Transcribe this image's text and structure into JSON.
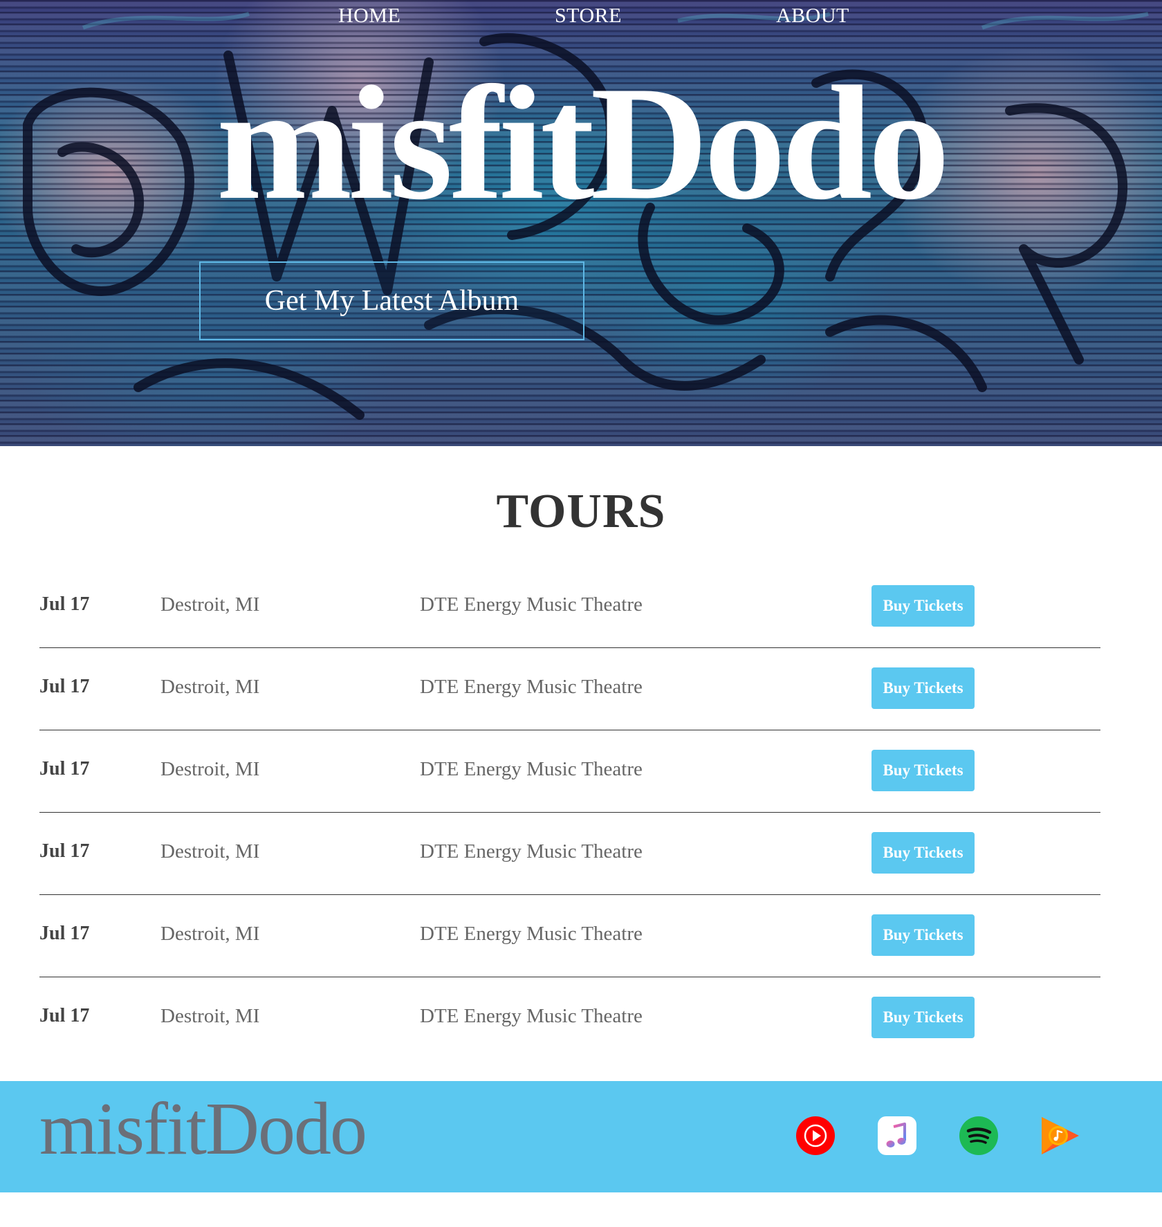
{
  "nav": {
    "home": "HOME",
    "store": "STORE",
    "about": "ABOUT"
  },
  "hero": {
    "title": "misfitDodo",
    "cta_label": "Get My Latest Album"
  },
  "tours": {
    "heading": "TOURS",
    "rows": [
      {
        "date": "Jul 17",
        "city": "Destroit, MI",
        "venue": "DTE Energy Music Theatre",
        "button": "Buy Tickets"
      },
      {
        "date": "Jul 17",
        "city": "Destroit, MI",
        "venue": "DTE Energy Music Theatre",
        "button": "Buy Tickets"
      },
      {
        "date": "Jul 17",
        "city": "Destroit, MI",
        "venue": "DTE Energy Music Theatre",
        "button": "Buy Tickets"
      },
      {
        "date": "Jul 17",
        "city": "Destroit, MI",
        "venue": "DTE Energy Music Theatre",
        "button": "Buy Tickets"
      },
      {
        "date": "Jul 17",
        "city": "Destroit, MI",
        "venue": "DTE Energy Music Theatre",
        "button": "Buy Tickets"
      },
      {
        "date": "Jul 17",
        "city": "Destroit, MI",
        "venue": "DTE Energy Music Theatre",
        "button": "Buy Tickets"
      }
    ]
  },
  "footer": {
    "logo": "misfitDodo",
    "social_icons": [
      "youtube-music-icon",
      "apple-music-icon",
      "spotify-icon",
      "google-play-music-icon"
    ]
  },
  "colors": {
    "accent": "#5bc8f0",
    "cta_border": "#5fb8e6",
    "footer_logo": "#6b6f78",
    "youtube_red": "#ff0000",
    "spotify_green": "#1db954"
  }
}
